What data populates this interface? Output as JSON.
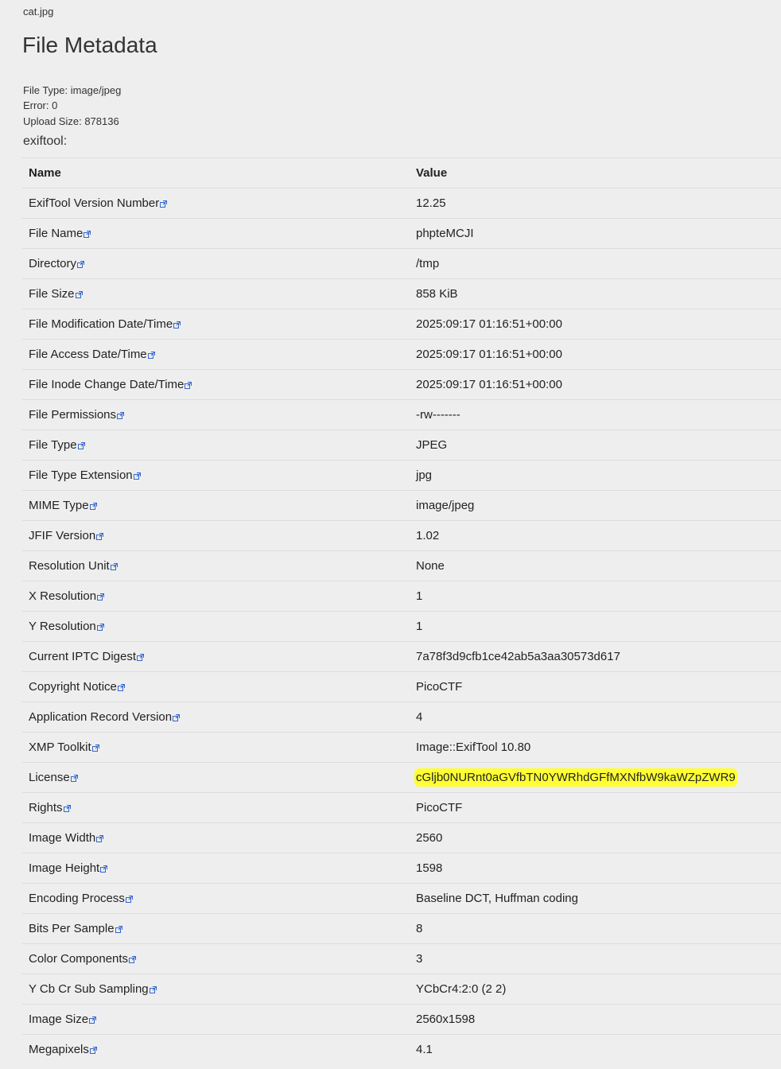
{
  "filename": "cat.jpg",
  "title": "File Metadata",
  "file_info": {
    "file_type": "File Type: image/jpeg",
    "error": "Error: 0",
    "upload_size": "Upload Size: 878136"
  },
  "tool_label": "exiftool:",
  "table": {
    "header_name": "Name",
    "header_value": "Value",
    "rows": [
      {
        "name": "ExifTool Version Number",
        "value": "12.25"
      },
      {
        "name": "File Name",
        "value": "phpteMCJI"
      },
      {
        "name": "Directory",
        "value": "/tmp"
      },
      {
        "name": "File Size",
        "value": "858 KiB"
      },
      {
        "name": "File Modification Date/Time",
        "value": "2025:09:17 01:16:51+00:00"
      },
      {
        "name": "File Access Date/Time",
        "value": "2025:09:17 01:16:51+00:00"
      },
      {
        "name": "File Inode Change Date/Time",
        "value": "2025:09:17 01:16:51+00:00"
      },
      {
        "name": "File Permissions",
        "value": "-rw-------"
      },
      {
        "name": "File Type",
        "value": "JPEG"
      },
      {
        "name": "File Type Extension",
        "value": "jpg"
      },
      {
        "name": "MIME Type",
        "value": "image/jpeg"
      },
      {
        "name": "JFIF Version",
        "value": "1.02"
      },
      {
        "name": "Resolution Unit",
        "value": "None"
      },
      {
        "name": "X Resolution",
        "value": "1"
      },
      {
        "name": "Y Resolution",
        "value": "1"
      },
      {
        "name": "Current IPTC Digest",
        "value": "7a78f3d9cfb1ce42ab5a3aa30573d617"
      },
      {
        "name": "Copyright Notice",
        "value": "PicoCTF"
      },
      {
        "name": "Application Record Version",
        "value": "4"
      },
      {
        "name": "XMP Toolkit",
        "value": "Image::ExifTool 10.80"
      },
      {
        "name": "License",
        "value": "cGljb0NURnt0aGVfbTN0YWRhdGFfMXNfbW9kaWZpZWR9",
        "highlighted": true
      },
      {
        "name": "Rights",
        "value": "PicoCTF"
      },
      {
        "name": "Image Width",
        "value": "2560"
      },
      {
        "name": "Image Height",
        "value": "1598"
      },
      {
        "name": "Encoding Process",
        "value": "Baseline DCT, Huffman coding"
      },
      {
        "name": "Bits Per Sample",
        "value": "8"
      },
      {
        "name": "Color Components",
        "value": "3"
      },
      {
        "name": "Y Cb Cr Sub Sampling",
        "value": "YCbCr4:2:0 (2 2)"
      },
      {
        "name": "Image Size",
        "value": "2560x1598"
      },
      {
        "name": "Megapixels",
        "value": "4.1"
      }
    ]
  },
  "colors": {
    "background": "#eeeeee",
    "highlight": "#ffff33",
    "link_icon": "#3366cc"
  },
  "icons": {
    "row_link": "external-link-icon"
  }
}
